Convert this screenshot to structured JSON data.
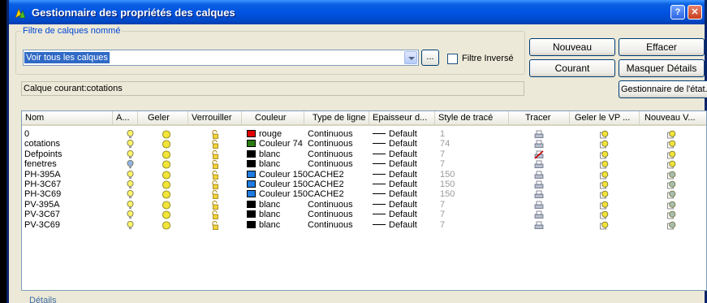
{
  "window": {
    "title": "Gestionnaire des propriétés des calques"
  },
  "filter": {
    "group_label": "Filtre de calques nommé",
    "value": "Voir tous les calques",
    "dots_label": "...",
    "invert_label": "Filtre Inversé"
  },
  "buttons": {
    "nouveau": "Nouveau",
    "effacer": "Effacer",
    "courant": "Courant",
    "masquer": "Masquer Détails",
    "gestionnaire": "Gestionnaire de l'état..."
  },
  "current_layer": "Calque courant:cotations",
  "columns": [
    "Nom",
    "A...",
    "Geler",
    "Verrouiller",
    "Couleur",
    "Type de ligne",
    "Epaisseur d...",
    "Style de tracé",
    "Tracer",
    "Geler le VP ...",
    "Nouveau V..."
  ],
  "rows": [
    {
      "name": "0",
      "on": true,
      "color_hex": "#e00000",
      "color_label": "rouge",
      "linetype": "Continuous",
      "lineweight": "Default",
      "style": "1",
      "plot_disabled": false,
      "vp_new": "yellow"
    },
    {
      "name": "cotations",
      "on": true,
      "color_hex": "#2a7a12",
      "color_label": "Couleur 74",
      "linetype": "Continuous",
      "lineweight": "Default",
      "style": "74",
      "plot_disabled": false,
      "vp_new": "yellow"
    },
    {
      "name": "Defpoints",
      "on": true,
      "color_hex": "#000000",
      "color_label": "blanc",
      "linetype": "Continuous",
      "lineweight": "Default",
      "style": "7",
      "plot_disabled": true,
      "vp_new": "yellow"
    },
    {
      "name": "fenetres",
      "on": false,
      "color_hex": "#000000",
      "color_label": "blanc",
      "linetype": "Continuous",
      "lineweight": "Default",
      "style": "7",
      "plot_disabled": false,
      "vp_new": "yellow"
    },
    {
      "name": "PH-395A",
      "on": true,
      "color_hex": "#1e7be0",
      "color_label": "Couleur 150",
      "linetype": "CACHE2",
      "lineweight": "Default",
      "style": "150",
      "plot_disabled": false,
      "vp_new": "grey"
    },
    {
      "name": "PH-3C67",
      "on": true,
      "color_hex": "#1e7be0",
      "color_label": "Couleur 150",
      "linetype": "CACHE2",
      "lineweight": "Default",
      "style": "150",
      "plot_disabled": false,
      "vp_new": "grey"
    },
    {
      "name": "PH-3C69",
      "on": true,
      "color_hex": "#1e7be0",
      "color_label": "Couleur 150",
      "linetype": "CACHE2",
      "lineweight": "Default",
      "style": "150",
      "plot_disabled": false,
      "vp_new": "grey"
    },
    {
      "name": "PV-395A",
      "on": true,
      "color_hex": "#000000",
      "color_label": "blanc",
      "linetype": "Continuous",
      "lineweight": "Default",
      "style": "7",
      "plot_disabled": false,
      "vp_new": "grey"
    },
    {
      "name": "PV-3C67",
      "on": true,
      "color_hex": "#000000",
      "color_label": "blanc",
      "linetype": "Continuous",
      "lineweight": "Default",
      "style": "7",
      "plot_disabled": false,
      "vp_new": "grey"
    },
    {
      "name": "PV-3C69",
      "on": true,
      "color_hex": "#000000",
      "color_label": "blanc",
      "linetype": "Continuous",
      "lineweight": "Default",
      "style": "7",
      "plot_disabled": false,
      "vp_new": "grey"
    }
  ],
  "details_label": "Détails",
  "icons": {
    "on": "lightbulb-icon",
    "freeze": "sun-icon",
    "lock": "padlock-icon",
    "plot": "printer-icon",
    "vp_freeze": "viewport-sun-icon"
  }
}
